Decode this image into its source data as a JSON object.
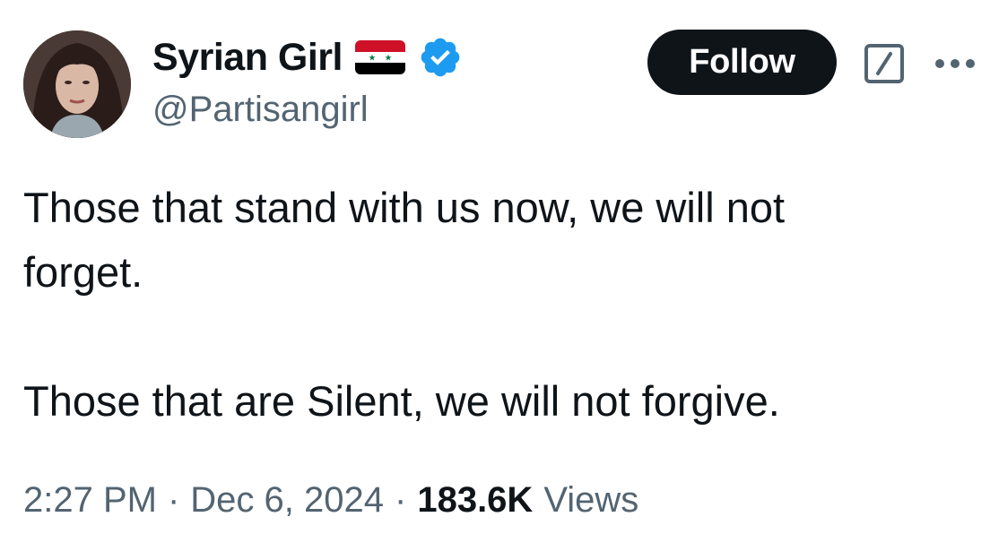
{
  "author": {
    "display_name": "Syrian Girl",
    "handle": "@Partisangirl",
    "flag_icon": "syria-flag-icon",
    "verified_icon": "verified-badge-icon",
    "verified_color": "#1d9bf0"
  },
  "actions": {
    "follow_label": "Follow",
    "grok_icon": "grok-icon",
    "more_icon": "more-options-icon"
  },
  "tweet": {
    "text": "Those that stand with us now, we will not\nforget.\n\nThose that are Silent, we will not forgive."
  },
  "meta": {
    "time": "2:27 PM",
    "separator": "·",
    "date": "Dec 6, 2024",
    "views_count": "183.6K",
    "views_label": "Views"
  },
  "colors": {
    "text_primary": "#0f1419",
    "text_secondary": "#536471",
    "button_bg": "#0f1419"
  }
}
